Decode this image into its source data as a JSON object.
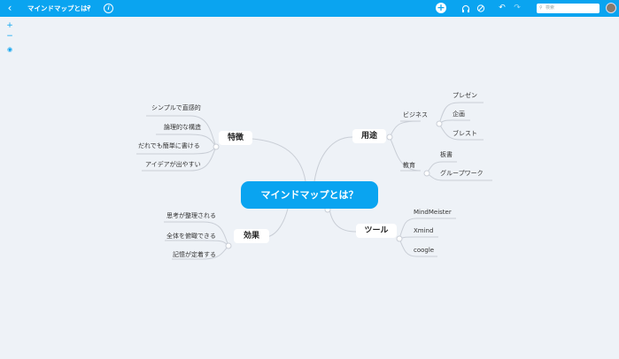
{
  "toolbar": {
    "back_icon": "‹",
    "title": "マインドマップとは？",
    "title_caret": "▾",
    "info_icon": "i",
    "add_icon": "+",
    "undo_icon": "↶",
    "redo_icon": "↷",
    "search_placeholder": "検索"
  },
  "sidebar": {
    "zoom_in": "+",
    "zoom_out": "−",
    "locate": "◉"
  },
  "map": {
    "central": "マインドマップとは？",
    "features": {
      "label": "特徴",
      "items": [
        "シンプルで直感的",
        "論理的な構造",
        "だれでも簡単に書ける",
        "アイデアが出やすい"
      ]
    },
    "effects": {
      "label": "効果",
      "items": [
        "思考が整理される",
        "全体を俯瞰できる",
        "記憶が定着する"
      ]
    },
    "uses": {
      "label": "用途",
      "business": {
        "label": "ビジネス",
        "items": [
          "プレゼン",
          "企画",
          "ブレスト"
        ]
      },
      "education": {
        "label": "教育",
        "items": [
          "板書",
          "グループワーク"
        ]
      }
    },
    "tools": {
      "label": "ツール",
      "items": [
        "MindMeister",
        "Xmind",
        "coogle"
      ]
    }
  }
}
